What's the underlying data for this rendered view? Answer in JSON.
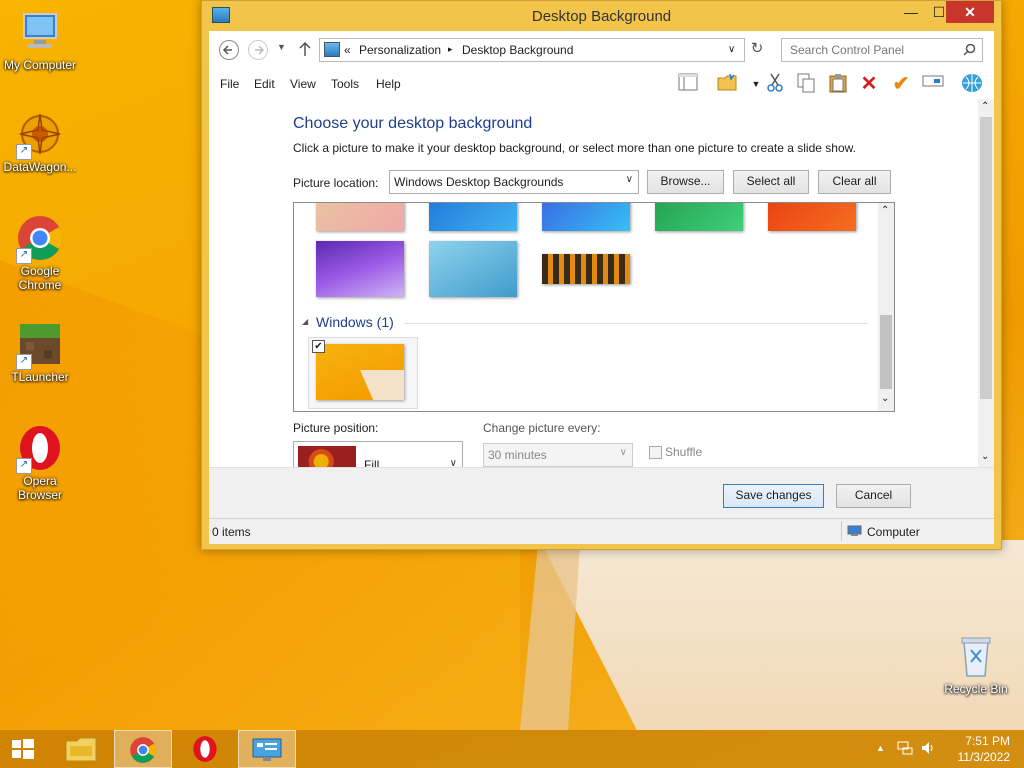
{
  "desktop": {
    "icons": [
      {
        "label": "My Computer"
      },
      {
        "label": "DataWagon..."
      },
      {
        "label": "Google Chrome"
      },
      {
        "label": "TLauncher"
      },
      {
        "label": "Opera Browser"
      },
      {
        "label": "Recycle Bin"
      }
    ]
  },
  "window": {
    "title": "Desktop Background",
    "controls": {
      "minimize": "—",
      "maximize": "☐",
      "close": "✕"
    }
  },
  "address": {
    "chevron": "«",
    "crumbs": [
      "Personalization",
      "Desktop Background"
    ],
    "separator": "▸",
    "search_placeholder": "Search Control Panel"
  },
  "menu": [
    "File",
    "Edit",
    "View",
    "Tools",
    "Help"
  ],
  "content": {
    "heading": "Choose your desktop background",
    "description": "Click a picture to make it your desktop background, or select more than one picture to create a slide show.",
    "picture_location_label": "Picture location:",
    "picture_location_value": "Windows Desktop Backgrounds",
    "browse_button": "Browse...",
    "select_all_button": "Select all",
    "clear_all_button": "Clear all",
    "group_label": "Windows (1)",
    "selected_checkbox": "✔",
    "picture_position_label": "Picture position:",
    "picture_position_value": "Fill",
    "change_every_label": "Change picture every:",
    "change_every_value": "30 minutes",
    "shuffle_label": "Shuffle"
  },
  "footer": {
    "save_button": "Save changes",
    "cancel_button": "Cancel"
  },
  "status": {
    "items": "0 items",
    "location": "Computer"
  },
  "taskbar": {
    "time": "7:51 PM",
    "date": "11/3/2022"
  }
}
